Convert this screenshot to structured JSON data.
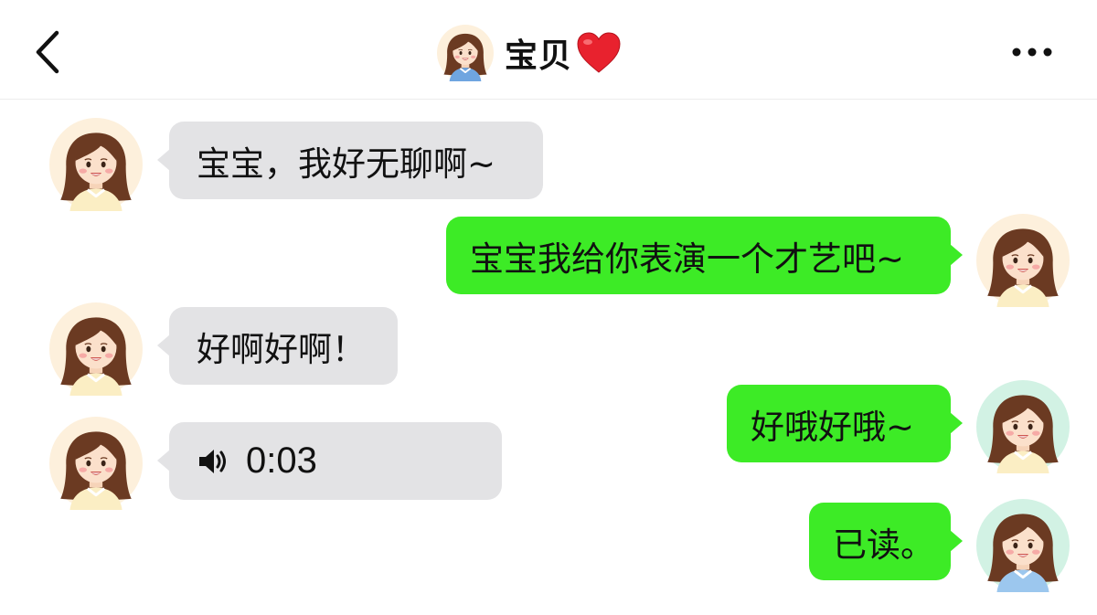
{
  "header": {
    "title": "宝贝",
    "back_icon": "chevron-left-icon",
    "more_icon": "more-dots-icon",
    "heart_icon": "red-heart-icon"
  },
  "colors": {
    "incoming_bubble": "#e3e3e5",
    "outgoing_bubble": "#3deb26",
    "avatar_bg_warm": "#fdf0dc",
    "avatar_bg_mint": "#d2f2e4",
    "heart": "#e8222e"
  },
  "messages": [
    {
      "side": "incoming",
      "text": "宝宝，我好无聊啊~"
    },
    {
      "side": "outgoing",
      "text": "宝宝我给你表演一个才艺吧~"
    },
    {
      "side": "incoming",
      "text": "好啊好啊！"
    },
    {
      "side": "outgoing",
      "text": "好哦好哦~"
    },
    {
      "side": "incoming",
      "type": "voice",
      "icon": "speaker-icon",
      "duration": "0:03"
    },
    {
      "side": "outgoing",
      "text": "已读。"
    }
  ]
}
